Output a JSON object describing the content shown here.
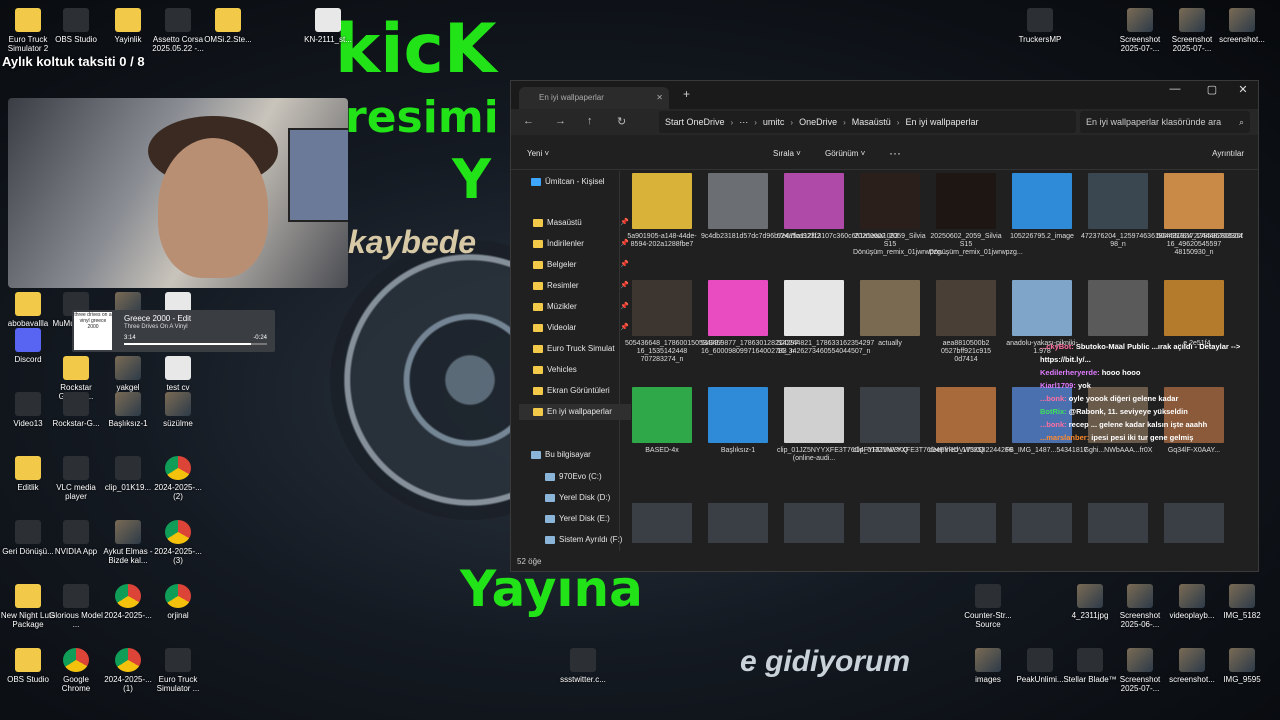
{
  "desktop": {
    "counter_text": "Aylık koltuk taksiti  0 / 8",
    "icons_left": [
      {
        "label": "Euro Truck Simulator 2",
        "icon": "folder-icon"
      },
      {
        "label": "OBS Studio",
        "icon": "obs-icon"
      },
      {
        "label": "Yayinlik",
        "icon": "folder-icon"
      },
      {
        "label": "Assetto Corsa 2025.05.22 -...",
        "icon": "video-icon"
      },
      {
        "label": "OMSi.2.Ste...",
        "icon": "folder-icon"
      },
      {
        "label": "KN-2111_st...",
        "icon": "document-icon"
      },
      {
        "label": "abobavallla",
        "icon": "folder-icon"
      },
      {
        "label": "MuMu Player 12",
        "icon": "app-icon"
      },
      {
        "label": "image0",
        "icon": "image-icon"
      },
      {
        "label": "Efe_erer_az...",
        "icon": "document-icon"
      },
      {
        "label": "Discord",
        "icon": "discord-icon"
      },
      {
        "label": "Rockstar Games ...",
        "icon": "folder-icon"
      },
      {
        "label": "yakgel",
        "icon": "image-icon"
      },
      {
        "label": "test cv",
        "icon": "document-icon"
      },
      {
        "label": "Video13",
        "icon": "video-icon"
      },
      {
        "label": "Rockstar-G...",
        "icon": "rockstar-icon"
      },
      {
        "label": "Başlıksız-1",
        "icon": "image-icon"
      },
      {
        "label": "süzülme",
        "icon": "image-icon"
      },
      {
        "label": "Editlik",
        "icon": "folder-icon"
      },
      {
        "label": "VLC media player",
        "icon": "vlc-icon"
      },
      {
        "label": "clip_01K19...",
        "icon": "video-icon"
      },
      {
        "label": "2024-2025-... (2)",
        "icon": "chrome-icon"
      },
      {
        "label": "Geri Dönüşü...",
        "icon": "recycle-bin-icon"
      },
      {
        "label": "NVIDIA App",
        "icon": "nvidia-icon"
      },
      {
        "label": "Aykut Elmas - Bizde kal...",
        "icon": "image-icon"
      },
      {
        "label": "2024-2025-... (3)",
        "icon": "chrome-icon"
      },
      {
        "label": "New Night Luts Package",
        "icon": "folder-icon"
      },
      {
        "label": "Glorious Model ...",
        "icon": "mouse-icon"
      },
      {
        "label": "2024-2025-...",
        "icon": "chrome-icon"
      },
      {
        "label": "orjinal",
        "icon": "chrome-icon"
      },
      {
        "label": "OBS Studio",
        "icon": "folder-icon"
      },
      {
        "label": "Google Chrome",
        "icon": "chrome-icon"
      },
      {
        "label": "2024-2025-... (1)",
        "icon": "chrome-icon"
      },
      {
        "label": "Euro Truck Simulator ...",
        "icon": "video-icon"
      },
      {
        "label": "ssstwitter.c...",
        "icon": "video-icon"
      }
    ],
    "icons_right": [
      {
        "label": "TruckersMP",
        "icon": "truckersmp-icon"
      },
      {
        "label": "Screenshot 2025-07-...",
        "icon": "image-icon"
      },
      {
        "label": "Screenshot 2025-07-...",
        "icon": "image-icon"
      },
      {
        "label": "screenshot...",
        "icon": "image-icon"
      },
      {
        "label": "Counter-Str... Source",
        "icon": "counter-strike-icon"
      },
      {
        "label": "4_2311jpg",
        "icon": "image-icon"
      },
      {
        "label": "Screenshot 2025-06-...",
        "icon": "image-icon"
      },
      {
        "label": "videoplayb...",
        "icon": "image-icon"
      },
      {
        "label": "IMG_5182",
        "icon": "image-icon"
      },
      {
        "label": "images",
        "icon": "image-icon"
      },
      {
        "label": "PeakUnlimi...",
        "icon": "settings-icon"
      },
      {
        "label": "Stellar Blade™",
        "icon": "game-icon"
      },
      {
        "label": "Screenshot 2025-07-...",
        "icon": "image-icon"
      },
      {
        "label": "screenshot...",
        "icon": "image-icon"
      },
      {
        "label": "IMG_9595",
        "icon": "image-icon"
      }
    ]
  },
  "music_widget": {
    "art_text": "three drives on a vinyl greece 2000",
    "title": "Greece 2000 - Edit",
    "subtitle": "Three Drives On A Vinyl",
    "elapsed": "3:14",
    "remaining": "-0:24",
    "progress": 0.89
  },
  "overlay": {
    "hand_kick": "kicK",
    "hand_resimi": "resimi",
    "hand_y": "Y",
    "hand_yayina": "Yayına",
    "kaybede": "kaybede",
    "gidiyorum": "e gidiyorum"
  },
  "explorer": {
    "tab_title": "En iyi wallpaperlar",
    "breadcrumb": [
      "Start OneDrive",
      "···",
      "umitc",
      "OneDrive",
      "Masaüstü",
      "En iyi wallpaperlar"
    ],
    "search_placeholder": "En iyi wallpaperlar klasöründe ara",
    "toolbar": {
      "new": "Yeni",
      "sort": "Sırala",
      "view": "Görünüm",
      "more": "···",
      "details": "Ayrıntılar"
    },
    "sidebar": [
      {
        "label": "Ümitcan - Kişisel",
        "pinned": false
      },
      {
        "label": "Masaüstü",
        "pinned": true
      },
      {
        "label": "İndirilenler",
        "pinned": true
      },
      {
        "label": "Belgeler",
        "pinned": true
      },
      {
        "label": "Resimler",
        "pinned": true
      },
      {
        "label": "Müzikler",
        "pinned": true
      },
      {
        "label": "Videolar",
        "pinned": true
      },
      {
        "label": "Euro Truck Simulat",
        "pinned": false
      },
      {
        "label": "Vehicles",
        "pinned": false
      },
      {
        "label": "Ekran Görüntüleri",
        "pinned": false
      },
      {
        "label": "En iyi wallpaperlar",
        "pinned": false
      },
      {
        "label": "Bu bilgisayar",
        "pinned": false
      },
      {
        "label": "970Evo (C:)",
        "pinned": false
      },
      {
        "label": "Yerel Disk (D:)",
        "pinned": false
      },
      {
        "label": "Yerel Disk (E:)",
        "pinned": false
      },
      {
        "label": "Sistem Ayrıldı (F:)",
        "pinned": false
      }
    ],
    "files": [
      {
        "name": "5a901905-a148-44de-8594-202a1288fbe7",
        "color": "#d9b23a"
      },
      {
        "name": "9c4db23181d57dc7d96b7e67fca923f2",
        "color": "#6b6f73"
      },
      {
        "name": "524a5a112f13107c360c651a1eaa1093",
        "color": "#b04aa8"
      },
      {
        "name": "20250602_2059_Silvia S15 Dönüşüm_remix_01jwrwpzg...",
        "color": "#2a1f1a"
      },
      {
        "name": "20250602_2059_Silvia S15 Dönüşüm_remix_01jwrwpzg...",
        "color": "#1e1612"
      },
      {
        "name": "105226795.2_image",
        "color": "#2f8ad8"
      },
      {
        "name": "472376204_125974636180455781722444828052063 98_n",
        "color": "#3a4650"
      },
      {
        "name": "504431824_178596708304297 16_49620545597 48150930_n",
        "color": "#c98a48"
      },
      {
        "name": "505436648_178600150534297 16_1535142448 707283274_n",
        "color": "#3d3530"
      },
      {
        "name": "519459877_178630128214297 16_6000980997164002783_n",
        "color": "#e84cc0"
      },
      {
        "name": "520244821_178633162354297 16_3426273460554044507_n",
        "color": "#e6e6e6"
      },
      {
        "name": "actually",
        "color": "#7a6a52"
      },
      {
        "name": "aea8810500b2 0527bff921c915 0d7414",
        "color": "#4a3f36"
      },
      {
        "name": "anadolu-yakası-pikniki-1.978",
        "color": "#7fa6c9"
      },
      {
        "name": "...",
        "color": "#5a5a5a"
      },
      {
        "name": "...e 2e51f4",
        "color": "#b47b2c"
      },
      {
        "name": "BASED-4x",
        "color": "#2fa84a"
      },
      {
        "name": "Başlıksız-1",
        "color": "#2f8ad8"
      },
      {
        "name": "clip_01JZ5NYYXFE3T76D4FYRDVW3KQ (online-audi...",
        "color": "#d0d0d0"
      },
      {
        "name": "clip_01JZ5NYYXFE3T76D4FYRDVW3KQ",
        "color": "#3a3f45"
      },
      {
        "name": "deepfried_1752582244266",
        "color": "#a86a3a"
      },
      {
        "name": "FB_IMG_1487...54341817",
        "color": "#4a70b0"
      },
      {
        "name": "Gghi...NWbAAA...fr0X",
        "color": "#6a5a4a"
      },
      {
        "name": "Gq34lF-X0AAY...",
        "color": "#8a5a3a"
      }
    ],
    "status": "52 öğe"
  },
  "chat": [
    {
      "user": "...ckyBot:",
      "text": "Sbutoko-Maal Public ...ırak açıldı - Detaylar --> https://bit.ly/...",
      "cls": "u"
    },
    {
      "user": "Kedilerheryerde:",
      "text": "hooo hooo",
      "cls": "u2"
    },
    {
      "user": "Kiarl1709:",
      "text": "yok",
      "cls": "u2"
    },
    {
      "user": "...bonk:",
      "text": "oyle yoook diğeri gelene kadar",
      "cls": "u"
    },
    {
      "user": "BotRix:",
      "text": "@Rabonk, 11. seviyeye yükseldin",
      "cls": "u4"
    },
    {
      "user": "...bonk:",
      "text": "recep ... gelene kadar kalsın işte aaahh",
      "cls": "u"
    },
    {
      "user": "...marslanber:",
      "text": "ipesi pesi iki tur gene gelmiş",
      "cls": "u3"
    }
  ]
}
